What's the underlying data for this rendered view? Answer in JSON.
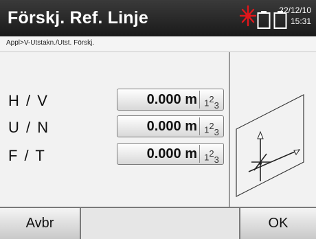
{
  "header": {
    "title": "Förskj. Ref. Linje",
    "date": "22/12/10",
    "time": "15:31",
    "icons": [
      "laser-icon",
      "battery-icon",
      "battery-icon"
    ],
    "laser_color": "#e0161b"
  },
  "breadcrumb": "Appl>V-Utstakn./Utst. Förskj.",
  "rows": [
    {
      "label": "H / V",
      "value": "0.000 m",
      "input_icon": "numpad-icon"
    },
    {
      "label": "U / N",
      "value": "0.000 m",
      "input_icon": "numpad-icon"
    },
    {
      "label": "F / T",
      "value": "0.000 m",
      "input_icon": "numpad-icon"
    }
  ],
  "numpad_glyph": {
    "a": "1",
    "b": "2",
    "c": "3"
  },
  "footer": {
    "left": "Avbr",
    "middle": "",
    "right": "OK"
  }
}
